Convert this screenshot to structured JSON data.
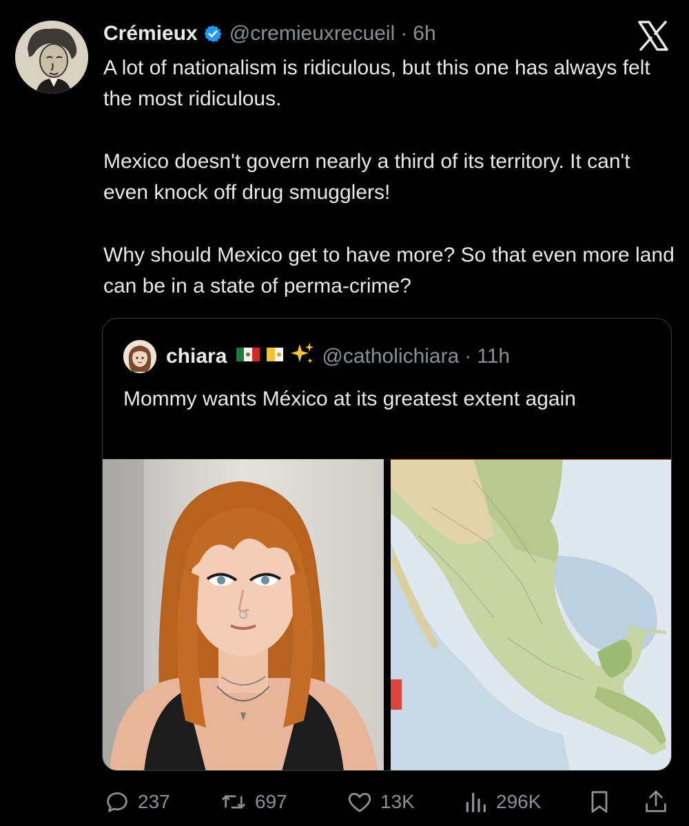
{
  "tweet": {
    "author": {
      "name": "Crémieux",
      "handle": "@cremieuxrecueil",
      "verified": true
    },
    "time": "6h",
    "separator": "·",
    "paragraphs": [
      "A lot of nationalism is ridiculous, but this one has always felt the most ridiculous.",
      "Mexico doesn't govern nearly a third of its territory. It can't even knock off drug smugglers!",
      "Why should Mexico get to have more? So that even more land can be in a state of perma-crime?"
    ]
  },
  "quote": {
    "author": {
      "name": "chiara",
      "handle": "@catholichiara",
      "emojis": [
        "🇲🇽",
        "🇻🇦",
        "✨"
      ]
    },
    "time": "11h",
    "separator": "·",
    "text": "Mommy wants México at its greatest extent again",
    "media": [
      {
        "kind": "photo",
        "description_icon": "person-photo"
      },
      {
        "kind": "map",
        "description_icon": "map-image"
      }
    ]
  },
  "actions": {
    "replies": "237",
    "retweets": "697",
    "likes": "13K",
    "views": "296K"
  },
  "icons": {
    "brand": "x-logo",
    "verified": "verified-badge-icon",
    "reply": "reply-icon",
    "retweet": "retweet-icon",
    "like": "heart-icon",
    "views": "views-icon",
    "bookmark": "bookmark-icon",
    "share": "share-icon"
  },
  "colors": {
    "background": "#000000",
    "text": "#e7e9ea",
    "muted": "#8b9096",
    "verified": "#1d9bf0",
    "border": "#3a3d41"
  }
}
